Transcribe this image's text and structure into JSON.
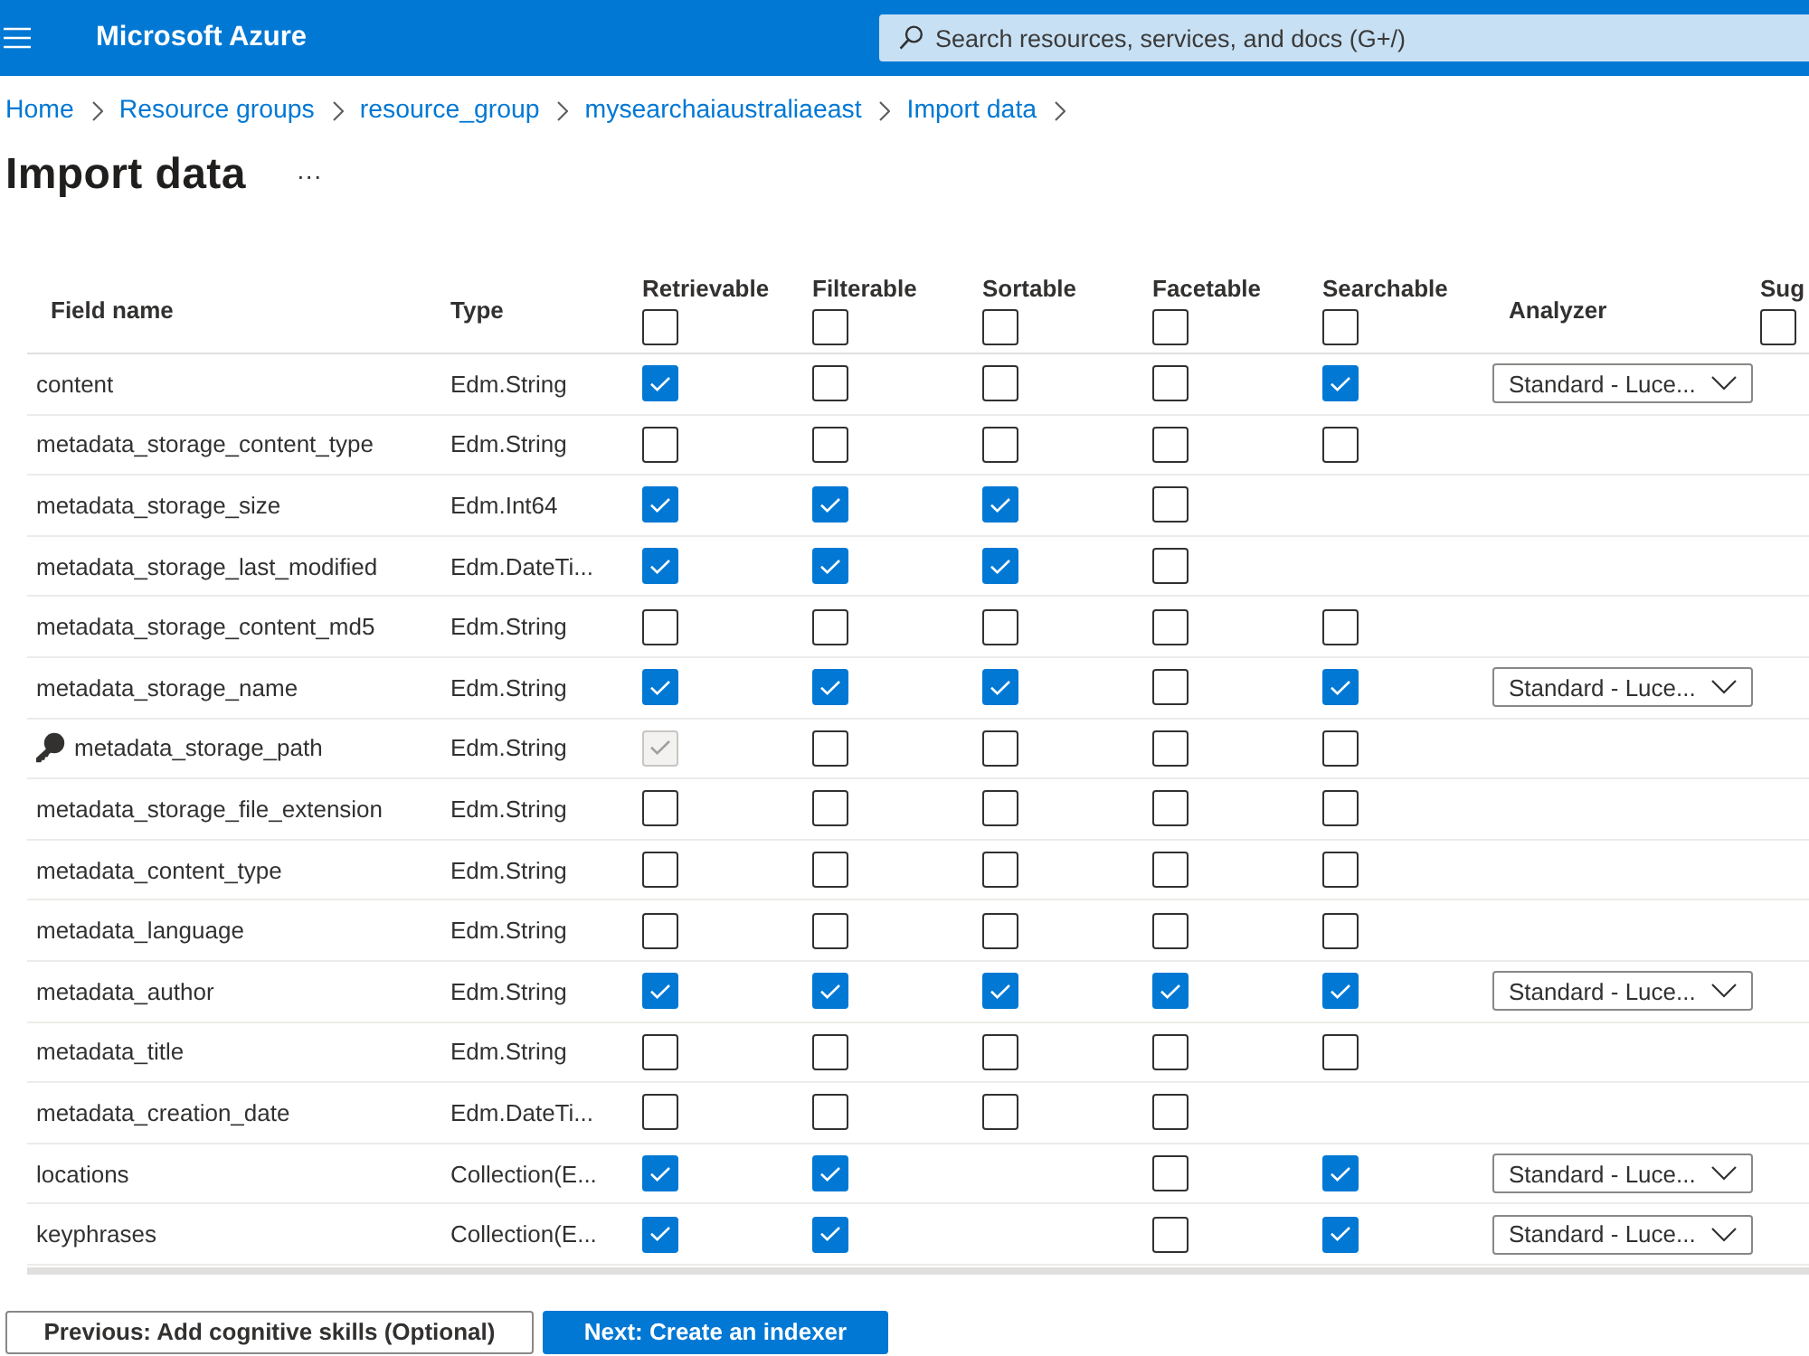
{
  "top_bar": {
    "title": "Microsoft Azure",
    "search": {
      "placeholder": "Search resources, services, and docs (G+/)"
    }
  },
  "breadcrumb": [
    "Home",
    "Resource groups",
    "resource_group",
    "mysearchaiaustraliaeast",
    "Import data"
  ],
  "page": {
    "title": "Import data",
    "more": "···"
  },
  "table": {
    "columns": [
      {
        "kind": "field",
        "label": "Field name"
      },
      {
        "kind": "type",
        "label": "Type"
      },
      {
        "kind": "checkbox",
        "label": "Retrievable",
        "checked": false
      },
      {
        "kind": "checkbox",
        "label": "Filterable",
        "checked": false
      },
      {
        "kind": "checkbox",
        "label": "Sortable",
        "checked": false
      },
      {
        "kind": "checkbox",
        "label": "Facetable",
        "checked": false
      },
      {
        "kind": "checkbox",
        "label": "Searchable",
        "checked": false
      },
      {
        "kind": "analyzer",
        "label": "Analyzer"
      },
      {
        "kind": "checkbox",
        "label": "Sug",
        "checked": false
      }
    ],
    "rows": [
      {
        "name": "content",
        "key": false,
        "type": "Edm.String",
        "checks": [
          {
            "kind": "checkbox",
            "checked": true,
            "disabled": false
          },
          {
            "kind": "checkbox",
            "checked": false,
            "disabled": false
          },
          {
            "kind": "checkbox",
            "checked": false,
            "disabled": false
          },
          {
            "kind": "checkbox",
            "checked": false,
            "disabled": false
          },
          {
            "kind": "checkbox",
            "checked": true,
            "disabled": false
          }
        ],
        "analyzer": "Standard - Luce..."
      },
      {
        "name": "metadata_storage_content_type",
        "key": false,
        "type": "Edm.String",
        "checks": [
          {
            "kind": "checkbox",
            "checked": false,
            "disabled": false
          },
          {
            "kind": "checkbox",
            "checked": false,
            "disabled": false
          },
          {
            "kind": "checkbox",
            "checked": false,
            "disabled": false
          },
          {
            "kind": "checkbox",
            "checked": false,
            "disabled": false
          },
          {
            "kind": "checkbox",
            "checked": false,
            "disabled": false
          }
        ]
      },
      {
        "name": "metadata_storage_size",
        "key": false,
        "type": "Edm.Int64",
        "checks": [
          {
            "kind": "checkbox",
            "checked": true,
            "disabled": false
          },
          {
            "kind": "checkbox",
            "checked": true,
            "disabled": false
          },
          {
            "kind": "checkbox",
            "checked": true,
            "disabled": false
          },
          {
            "kind": "checkbox",
            "checked": false,
            "disabled": false
          },
          {
            "kind": "empty"
          }
        ]
      },
      {
        "name": "metadata_storage_last_modified",
        "key": false,
        "type": "Edm.DateTi...",
        "checks": [
          {
            "kind": "checkbox",
            "checked": true,
            "disabled": false
          },
          {
            "kind": "checkbox",
            "checked": true,
            "disabled": false
          },
          {
            "kind": "checkbox",
            "checked": true,
            "disabled": false
          },
          {
            "kind": "checkbox",
            "checked": false,
            "disabled": false
          },
          {
            "kind": "empty"
          }
        ]
      },
      {
        "name": "metadata_storage_content_md5",
        "key": false,
        "type": "Edm.String",
        "checks": [
          {
            "kind": "checkbox",
            "checked": false,
            "disabled": false
          },
          {
            "kind": "checkbox",
            "checked": false,
            "disabled": false
          },
          {
            "kind": "checkbox",
            "checked": false,
            "disabled": false
          },
          {
            "kind": "checkbox",
            "checked": false,
            "disabled": false
          },
          {
            "kind": "checkbox",
            "checked": false,
            "disabled": false
          }
        ]
      },
      {
        "name": "metadata_storage_name",
        "key": false,
        "type": "Edm.String",
        "checks": [
          {
            "kind": "checkbox",
            "checked": true,
            "disabled": false
          },
          {
            "kind": "checkbox",
            "checked": true,
            "disabled": false
          },
          {
            "kind": "checkbox",
            "checked": true,
            "disabled": false
          },
          {
            "kind": "checkbox",
            "checked": false,
            "disabled": false
          },
          {
            "kind": "checkbox",
            "checked": true,
            "disabled": false
          }
        ],
        "analyzer": "Standard - Luce..."
      },
      {
        "name": "metadata_storage_path",
        "key": true,
        "type": "Edm.String",
        "checks": [
          {
            "kind": "checkbox",
            "checked": true,
            "disabled": true
          },
          {
            "kind": "checkbox",
            "checked": false,
            "disabled": false
          },
          {
            "kind": "checkbox",
            "checked": false,
            "disabled": false
          },
          {
            "kind": "checkbox",
            "checked": false,
            "disabled": false
          },
          {
            "kind": "checkbox",
            "checked": false,
            "disabled": false
          }
        ]
      },
      {
        "name": "metadata_storage_file_extension",
        "key": false,
        "type": "Edm.String",
        "checks": [
          {
            "kind": "checkbox",
            "checked": false,
            "disabled": false
          },
          {
            "kind": "checkbox",
            "checked": false,
            "disabled": false
          },
          {
            "kind": "checkbox",
            "checked": false,
            "disabled": false
          },
          {
            "kind": "checkbox",
            "checked": false,
            "disabled": false
          },
          {
            "kind": "checkbox",
            "checked": false,
            "disabled": false
          }
        ]
      },
      {
        "name": "metadata_content_type",
        "key": false,
        "type": "Edm.String",
        "checks": [
          {
            "kind": "checkbox",
            "checked": false,
            "disabled": false
          },
          {
            "kind": "checkbox",
            "checked": false,
            "disabled": false
          },
          {
            "kind": "checkbox",
            "checked": false,
            "disabled": false
          },
          {
            "kind": "checkbox",
            "checked": false,
            "disabled": false
          },
          {
            "kind": "checkbox",
            "checked": false,
            "disabled": false
          }
        ]
      },
      {
        "name": "metadata_language",
        "key": false,
        "type": "Edm.String",
        "checks": [
          {
            "kind": "checkbox",
            "checked": false,
            "disabled": false
          },
          {
            "kind": "checkbox",
            "checked": false,
            "disabled": false
          },
          {
            "kind": "checkbox",
            "checked": false,
            "disabled": false
          },
          {
            "kind": "checkbox",
            "checked": false,
            "disabled": false
          },
          {
            "kind": "checkbox",
            "checked": false,
            "disabled": false
          }
        ]
      },
      {
        "name": "metadata_author",
        "key": false,
        "type": "Edm.String",
        "checks": [
          {
            "kind": "checkbox",
            "checked": true,
            "disabled": false
          },
          {
            "kind": "checkbox",
            "checked": true,
            "disabled": false
          },
          {
            "kind": "checkbox",
            "checked": true,
            "disabled": false
          },
          {
            "kind": "checkbox",
            "checked": true,
            "disabled": false
          },
          {
            "kind": "checkbox",
            "checked": true,
            "disabled": false
          }
        ],
        "analyzer": "Standard - Luce..."
      },
      {
        "name": "metadata_title",
        "key": false,
        "type": "Edm.String",
        "checks": [
          {
            "kind": "checkbox",
            "checked": false,
            "disabled": false
          },
          {
            "kind": "checkbox",
            "checked": false,
            "disabled": false
          },
          {
            "kind": "checkbox",
            "checked": false,
            "disabled": false
          },
          {
            "kind": "checkbox",
            "checked": false,
            "disabled": false
          },
          {
            "kind": "checkbox",
            "checked": false,
            "disabled": false
          }
        ]
      },
      {
        "name": "metadata_creation_date",
        "key": false,
        "type": "Edm.DateTi...",
        "checks": [
          {
            "kind": "checkbox",
            "checked": false,
            "disabled": false
          },
          {
            "kind": "checkbox",
            "checked": false,
            "disabled": false
          },
          {
            "kind": "checkbox",
            "checked": false,
            "disabled": false
          },
          {
            "kind": "checkbox",
            "checked": false,
            "disabled": false
          },
          {
            "kind": "empty"
          }
        ]
      },
      {
        "name": "locations",
        "key": false,
        "type": "Collection(E...",
        "checks": [
          {
            "kind": "checkbox",
            "checked": true,
            "disabled": false
          },
          {
            "kind": "checkbox",
            "checked": true,
            "disabled": false
          },
          {
            "kind": "empty"
          },
          {
            "kind": "checkbox",
            "checked": false,
            "disabled": false
          },
          {
            "kind": "checkbox",
            "checked": true,
            "disabled": false
          }
        ],
        "analyzer": "Standard - Luce..."
      },
      {
        "name": "keyphrases",
        "key": false,
        "type": "Collection(E...",
        "checks": [
          {
            "kind": "checkbox",
            "checked": true,
            "disabled": false
          },
          {
            "kind": "checkbox",
            "checked": true,
            "disabled": false
          },
          {
            "kind": "empty"
          },
          {
            "kind": "checkbox",
            "checked": false,
            "disabled": false
          },
          {
            "kind": "checkbox",
            "checked": true,
            "disabled": false
          }
        ],
        "analyzer": "Standard - Luce..."
      }
    ]
  },
  "footer": {
    "buttons": [
      {
        "label": "Previous: Add cognitive skills (Optional)",
        "kind": "secondary"
      },
      {
        "label": "Next: Create an indexer",
        "kind": "primary"
      }
    ]
  }
}
